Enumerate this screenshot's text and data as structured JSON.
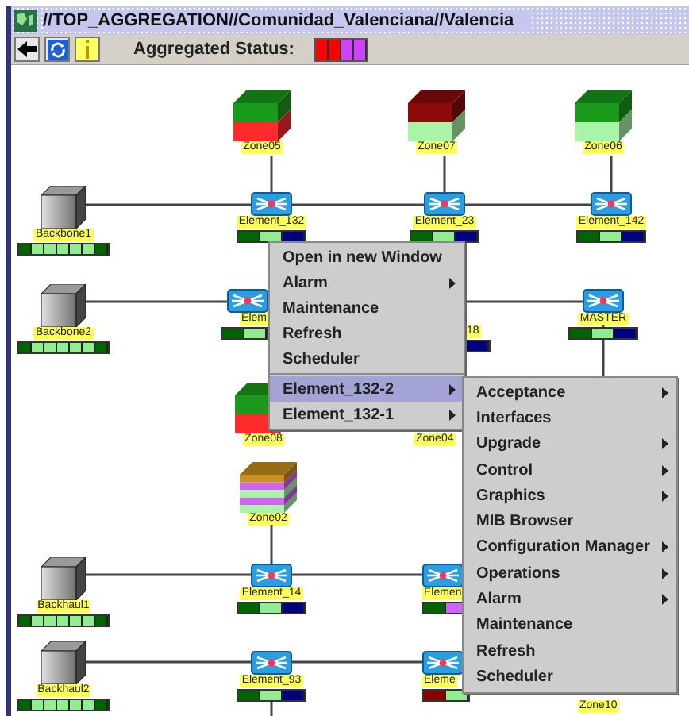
{
  "window": {
    "title": "//TOP_AGGREGATION//Comunidad_Valenciana//Valencia"
  },
  "toolbar": {
    "status_label": "Aggregated Status:",
    "aggregated_status": [
      {
        "color": "#ff0000"
      },
      {
        "color": "#ff0000"
      },
      {
        "color": "#cc44ff"
      },
      {
        "color": "#cc44ff"
      }
    ]
  },
  "nodes": [
    {
      "kind": "zone",
      "label": "Zone05",
      "layers": [
        {
          "color": "#1a9a1a"
        },
        {
          "color": "#ff2a2a"
        }
      ]
    },
    {
      "kind": "zone",
      "label": "Zone07",
      "layers": [
        {
          "color": "#8b0a0a"
        },
        {
          "color": "#a8f5a8"
        }
      ]
    },
    {
      "kind": "zone",
      "label": "Zone06",
      "layers": [
        {
          "color": "#1a9a1a"
        },
        {
          "color": "#a8f5a8"
        }
      ]
    },
    {
      "kind": "server",
      "label": "Backbone1",
      "segments": [
        {
          "color": "#006400"
        },
        {
          "color": "#90ee90"
        },
        {
          "color": "#90ee90"
        },
        {
          "color": "#90ee90"
        },
        {
          "color": "#90ee90"
        },
        {
          "color": "#90ee90"
        },
        {
          "color": "#006400"
        }
      ]
    },
    {
      "kind": "switch",
      "label": "Element_132",
      "segments": [
        {
          "color": "#006400"
        },
        {
          "color": "#90ee90"
        },
        {
          "color": "#000080"
        }
      ]
    },
    {
      "kind": "switch",
      "label": "Element_23",
      "segments": [
        {
          "color": "#006400"
        },
        {
          "color": "#90ee90"
        },
        {
          "color": "#000080"
        }
      ]
    },
    {
      "kind": "switch",
      "label": "Element_142",
      "segments": [
        {
          "color": "#006400"
        },
        {
          "color": "#90ee90"
        },
        {
          "color": "#000080"
        }
      ]
    },
    {
      "kind": "server",
      "label": "Backbone2",
      "segments": [
        {
          "color": "#006400"
        },
        {
          "color": "#90ee90"
        },
        {
          "color": "#90ee90"
        },
        {
          "color": "#90ee90"
        },
        {
          "color": "#90ee90"
        },
        {
          "color": "#90ee90"
        },
        {
          "color": "#006400"
        }
      ]
    },
    {
      "kind": "switch",
      "label": "Elem",
      "segments": [
        {
          "color": "#006400"
        },
        {
          "color": "#90ee90"
        }
      ]
    },
    {
      "kind": "fragment",
      "label": "18",
      "segments": [
        {
          "color": "#000080"
        }
      ]
    },
    {
      "kind": "switch",
      "label": "MASTER",
      "segments": [
        {
          "color": "#006400"
        },
        {
          "color": "#90ee90"
        },
        {
          "color": "#000080"
        }
      ]
    },
    {
      "kind": "zone",
      "label": "Zone08",
      "layers": [
        {
          "color": "#1a9a1a"
        },
        {
          "color": "#ff2a2a"
        }
      ]
    },
    {
      "kind": "fragment",
      "label": "Zone04"
    },
    {
      "kind": "zone",
      "label": "Zone02",
      "layers": [
        {
          "color": "#c8901e"
        },
        {
          "color": "#cc66ee"
        },
        {
          "color": "#a8f5a8"
        },
        {
          "color": "#cc66ee"
        },
        {
          "color": "#a8f5a8"
        }
      ]
    },
    {
      "kind": "server",
      "label": "Backhaul1",
      "segments": [
        {
          "color": "#006400"
        },
        {
          "color": "#90ee90"
        },
        {
          "color": "#90ee90"
        },
        {
          "color": "#90ee90"
        },
        {
          "color": "#90ee90"
        },
        {
          "color": "#90ee90"
        },
        {
          "color": "#006400"
        }
      ]
    },
    {
      "kind": "switch",
      "label": "Element_14",
      "segments": [
        {
          "color": "#006400"
        },
        {
          "color": "#90ee90"
        },
        {
          "color": "#000080"
        }
      ]
    },
    {
      "kind": "switch",
      "label": "Elemen",
      "segments": [
        {
          "color": "#006400"
        },
        {
          "color": "#cc66ff"
        }
      ]
    },
    {
      "kind": "server",
      "label": "Backhaul2",
      "segments": [
        {
          "color": "#006400"
        },
        {
          "color": "#90ee90"
        },
        {
          "color": "#90ee90"
        },
        {
          "color": "#90ee90"
        },
        {
          "color": "#90ee90"
        },
        {
          "color": "#90ee90"
        },
        {
          "color": "#006400"
        }
      ]
    },
    {
      "kind": "switch",
      "label": "Element_93",
      "segments": [
        {
          "color": "#006400"
        },
        {
          "color": "#90ee90"
        },
        {
          "color": "#000080"
        }
      ]
    },
    {
      "kind": "switch",
      "label": "Eleme",
      "segments": [
        {
          "color": "#8b0000"
        },
        {
          "color": "#90ee90"
        }
      ]
    },
    {
      "kind": "fragment",
      "label": "Zone10"
    }
  ],
  "context_menu": {
    "actions": [
      {
        "label": "Open in new Window",
        "has_submenu": false
      },
      {
        "label": "Alarm",
        "has_submenu": true
      },
      {
        "label": "Maintenance",
        "has_submenu": false
      },
      {
        "label": "Refresh",
        "has_submenu": false
      },
      {
        "label": "Scheduler",
        "has_submenu": false
      }
    ],
    "devices": [
      {
        "label": "Element_132-2",
        "has_submenu": true,
        "selected": true
      },
      {
        "label": "Element_132-1",
        "has_submenu": true,
        "selected": false
      }
    ]
  },
  "submenu": {
    "items": [
      {
        "label": "Acceptance",
        "has_submenu": true
      },
      {
        "label": "Interfaces",
        "has_submenu": false
      },
      {
        "label": "Upgrade",
        "has_submenu": true
      },
      {
        "label": "Control",
        "has_submenu": true
      },
      {
        "label": "Graphics",
        "has_submenu": true
      },
      {
        "label": "MIB Browser",
        "has_submenu": false
      },
      {
        "label": "Configuration Manager",
        "has_submenu": true
      },
      {
        "label": "Operations",
        "has_submenu": true
      },
      {
        "label": "Alarm",
        "has_submenu": true
      },
      {
        "label": "Maintenance",
        "has_submenu": false
      },
      {
        "label": "Refresh",
        "has_submenu": false
      },
      {
        "label": "Scheduler",
        "has_submenu": false
      }
    ]
  }
}
